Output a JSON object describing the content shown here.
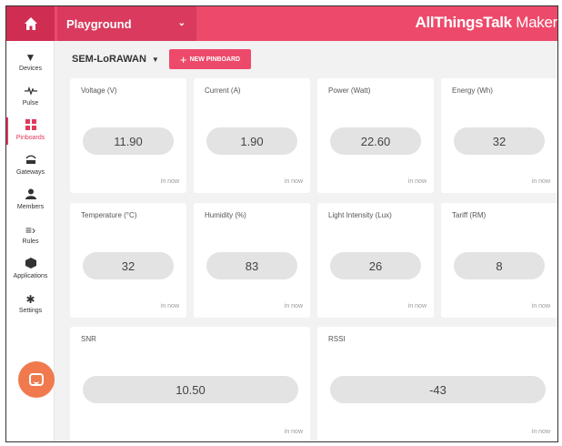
{
  "header": {
    "home_icon": "home-icon",
    "ground_label": "Playground",
    "brand_bold": "AllThings",
    "brand_light": "Talk",
    "brand_tail": " Maker",
    "accent": "#ed4a6b"
  },
  "sidebar": {
    "items": [
      {
        "label": "Devices",
        "icon": "plug-icon"
      },
      {
        "label": "Pulse",
        "icon": "pulse-icon"
      },
      {
        "label": "Pinboards",
        "icon": "pinboard-icon"
      },
      {
        "label": "Gateways",
        "icon": "gateway-icon"
      },
      {
        "label": "Members",
        "icon": "members-icon"
      },
      {
        "label": "Rules",
        "icon": "rules-icon"
      },
      {
        "label": "Applications",
        "icon": "applications-icon"
      },
      {
        "label": "Settings",
        "icon": "settings-icon"
      }
    ],
    "active": "Pinboards"
  },
  "toolbar": {
    "board_name": "SEM-LoRAWAN",
    "new_pinboard_label": "NEW PINBOARD"
  },
  "cards": [
    {
      "title": "Voltage (V)",
      "value": "11.90",
      "time": "in now"
    },
    {
      "title": "Current (A)",
      "value": "1.90",
      "time": "in now"
    },
    {
      "title": "Power (Watt)",
      "value": "22.60",
      "time": "in now"
    },
    {
      "title": "Energy (Wh)",
      "value": "32",
      "time": "in now"
    },
    {
      "title": "Temperature (°C)",
      "value": "32",
      "time": "in now"
    },
    {
      "title": "Humidity (%)",
      "value": "83",
      "time": "in now"
    },
    {
      "title": "Light Intensity (Lux)",
      "value": "26",
      "time": "in now"
    },
    {
      "title": "Tariff (RM)",
      "value": "8",
      "time": "in now"
    },
    {
      "title": "SNR",
      "value": "10.50",
      "time": "in now"
    },
    {
      "title": "RSSI",
      "value": "-43",
      "time": "in now"
    }
  ]
}
